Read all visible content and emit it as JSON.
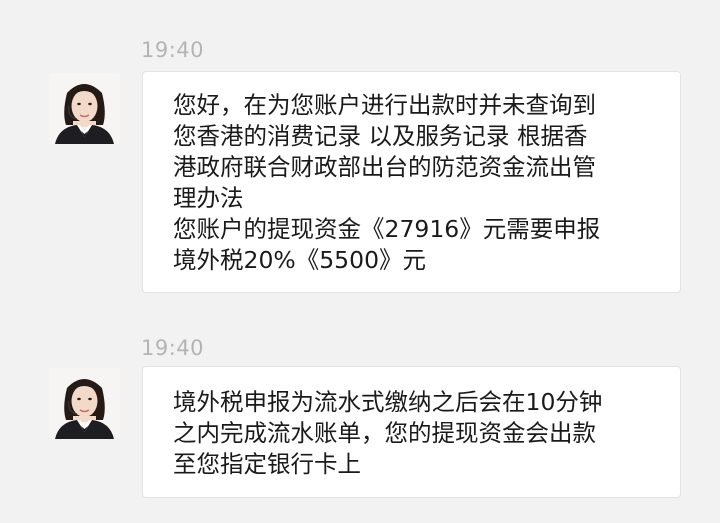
{
  "messages": [
    {
      "timestamp": "19:40",
      "text": "您好，在为您账户进行出款时并未查询到\n您香港的消费记录 以及服务记录 根据香\n港政府联合财政部出台的防范资金流出管\n理办法\n您账户的提现资金《27916》元需要申报\n境外税20%《5500》元"
    },
    {
      "timestamp": "19:40",
      "text": "境外税申报为流水式缴纳之后会在10分钟\n之内完成流水账单，您的提现资金会出款\n至您指定银行卡上"
    }
  ]
}
